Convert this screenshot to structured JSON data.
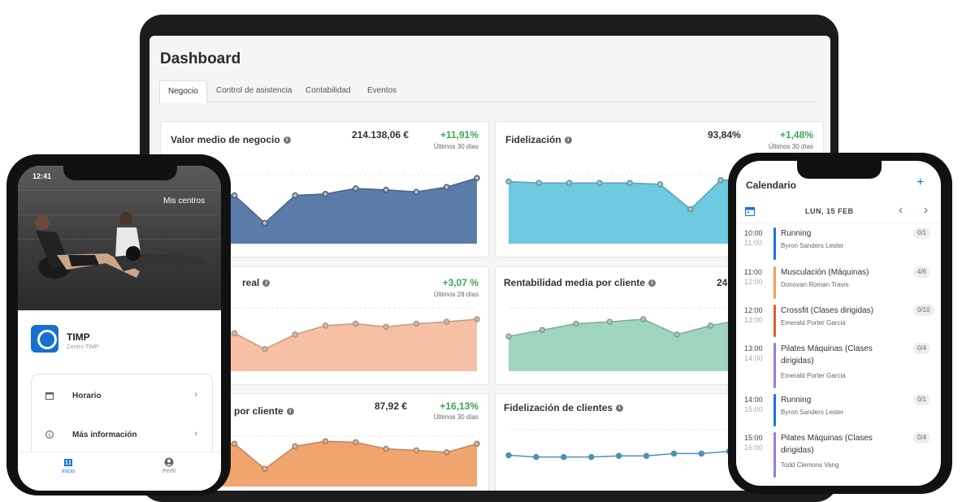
{
  "dashboard": {
    "title": "Dashboard",
    "tabs": [
      {
        "label": "Negocio",
        "active": true
      },
      {
        "label": "Control de asistencia",
        "active": false
      },
      {
        "label": "Contabilidad",
        "active": false
      },
      {
        "label": "Eventos",
        "active": false
      }
    ],
    "cards": [
      {
        "title": "Valor medio de negocio",
        "value": "214.138,06 €",
        "change": "+11,91%",
        "period": "Últimos 30 días",
        "color": "#5b7ba9"
      },
      {
        "title": "Fidelización",
        "value": "93,84%",
        "change": "+1,48%",
        "period": "Últimos 30 días",
        "color": "#6dcae0"
      },
      {
        "title": "real",
        "value": "",
        "change": "+3,07 %",
        "period": "Últimos 28 días",
        "color": "#f6c0a4"
      },
      {
        "title": "Rentabilidad media por cliente",
        "value": "24",
        "change": "",
        "period": "",
        "color": "#9fd5bf"
      },
      {
        "title": "por cliente",
        "value": "87,92 €",
        "change": "+16,13%",
        "period": "Últimos 30 días",
        "color": "#f1a56e"
      },
      {
        "title": "Fidelización de clientes",
        "value": "",
        "change": "",
        "period": "",
        "color": "#4c93b0"
      }
    ]
  },
  "chart_data": [
    {
      "type": "area",
      "values": [
        6,
        7.5,
        7,
        3,
        7,
        7.2,
        8,
        7.8,
        7.5,
        8.2,
        9.5
      ],
      "color": "#5b7ba9"
    },
    {
      "type": "area",
      "values": [
        9,
        8.8,
        8.8,
        8.8,
        8.8,
        8.6,
        5,
        9.2,
        9.2,
        9,
        8.8
      ],
      "color": "#6dcae0"
    },
    {
      "type": "area",
      "values": [
        6.2,
        6.2,
        6,
        3.5,
        5.8,
        7.2,
        7.5,
        7,
        7.5,
        7.8,
        8.2
      ],
      "color": "#f6c0a4"
    },
    {
      "type": "area",
      "values": [
        5.5,
        6.5,
        7.5,
        7.8,
        8.2,
        5.8,
        7.2,
        8.2,
        7.8,
        8.2
      ],
      "color": "#9fd5bf"
    },
    {
      "type": "area",
      "values": [
        8.5,
        8.5,
        8.5,
        3.5,
        8,
        9,
        8.8,
        7.5,
        7.2,
        6.8,
        8.5
      ],
      "color": "#f1a56e"
    },
    {
      "type": "line",
      "values": [
        5.5,
        5.2,
        5.2,
        5.2,
        5.4,
        5.4,
        5.8,
        5.8,
        6.2,
        6.4,
        6.2,
        6
      ],
      "color": "#4c93b0"
    }
  ],
  "phone_left": {
    "time": "12:41",
    "hero_label": "Mis centros",
    "center_name": "TIMP",
    "center_sub": "Centro TIMP",
    "menu": [
      {
        "label": "Horario",
        "icon": "calendar-icon"
      },
      {
        "label": "Más información",
        "icon": "info-icon"
      }
    ],
    "nav": [
      {
        "label": "Inicio",
        "icon": "building-icon",
        "active": true
      },
      {
        "label": "Perfil",
        "icon": "user-icon",
        "active": false
      }
    ]
  },
  "phone_right": {
    "title": "Calendario",
    "add_label": "+",
    "date": "LUN, 15 FEB",
    "prev": "‹",
    "next": "›",
    "events": [
      {
        "start": "10:00",
        "end": "11:00",
        "title": "Running",
        "who": "Byron Sanders Lester",
        "count": "0/1",
        "color": "#1a73e8"
      },
      {
        "start": "11:00",
        "end": "12:00",
        "title": "Musculación (Máquinas)",
        "who": "Donovan Roman Travis",
        "count": "4/6",
        "color": "#f0a04b"
      },
      {
        "start": "12:00",
        "end": "13:00",
        "title": "Crossfit (Clases dirigidas)",
        "who": "Emerald Porter Garcia",
        "count": "0/10",
        "color": "#e25b2e"
      },
      {
        "start": "13:00",
        "end": "14:00",
        "title": "Pilates Máquinas (Clases dirigidas)",
        "who": "Emerald Porter Garcia",
        "count": "0/4",
        "color": "#9b7ad8"
      },
      {
        "start": "14:00",
        "end": "15:00",
        "title": "Running",
        "who": "Byron Sanders Lester",
        "count": "0/1",
        "color": "#1a73e8"
      },
      {
        "start": "15:00",
        "end": "16:00",
        "title": "Pilates Máquinas (Clases dirigidas)",
        "who": "Todd Clemons Vang",
        "count": "0/4",
        "color": "#9b7ad8"
      }
    ]
  }
}
